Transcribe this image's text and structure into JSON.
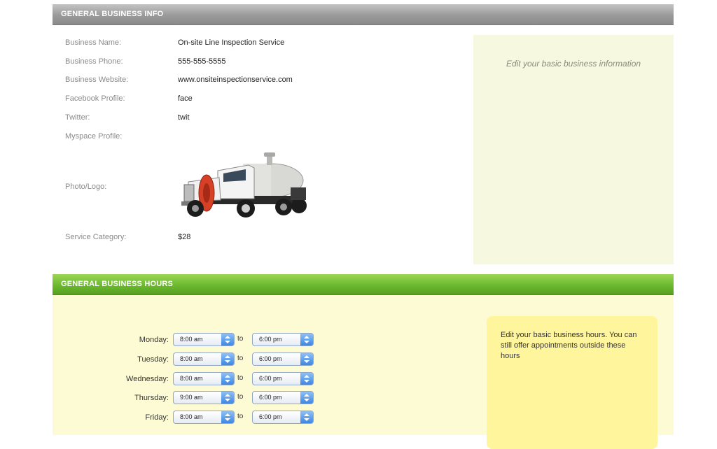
{
  "business_info": {
    "header": "General Business Info",
    "fields": [
      {
        "label": "Business Name:",
        "value": "On-site Line Inspection Service"
      },
      {
        "label": "Business Phone:",
        "value": "555-555-5555"
      },
      {
        "label": "Business Website:",
        "value": "www.onsiteinspectionservice.com"
      },
      {
        "label": "Facebook Profile:",
        "value": "face"
      },
      {
        "label": "Twitter:",
        "value": "twit"
      },
      {
        "label": "Myspace Profile:",
        "value": ""
      },
      {
        "label": "Photo/Logo:",
        "value": ""
      },
      {
        "label": "Service Category:",
        "value": "$28"
      }
    ],
    "help_text": "Edit your basic business information"
  },
  "business_hours": {
    "header": "General Business Hours",
    "to_label": "to",
    "days": [
      {
        "day": "Monday:",
        "open": "8:00 am",
        "close": "6:00 pm"
      },
      {
        "day": "Tuesday:",
        "open": "8:00 am",
        "close": "6:00 pm"
      },
      {
        "day": "Wednesday:",
        "open": "8:00 am",
        "close": "6:00 pm"
      },
      {
        "day": "Thursday:",
        "open": "9:00 am",
        "close": "6:00 pm"
      },
      {
        "day": "Friday:",
        "open": "8:00 am",
        "close": "6:00 pm"
      }
    ],
    "help_text": "Edit your basic business hours. You can still offer appointments outside these hours"
  },
  "colors": {
    "info_bar": "#9a9a9a",
    "hours_bar": "#6cb92f",
    "info_help_bg": "#f6f8e0",
    "hours_bg": "#fdfbd4",
    "hours_help_bg": "#fff59c",
    "select_arrow": "#3d87e2"
  },
  "icons": {
    "logo": "tanker-truck-image",
    "select_arrow": "updown-arrows-icon"
  }
}
